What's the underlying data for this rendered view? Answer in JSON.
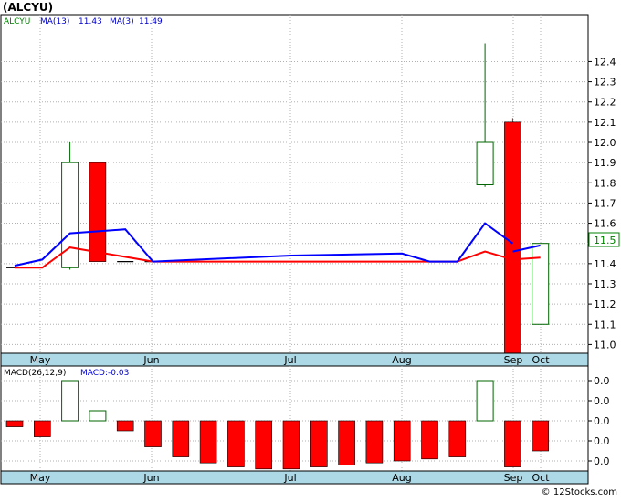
{
  "title": "(ALCYU)",
  "legend": {
    "ticker": "ALCYU",
    "ma13_label": "MA(13)",
    "ma13_value": "11.43",
    "ma3_label": "MA(3)",
    "ma3_value": "11.49"
  },
  "macd_legend": {
    "label": "MACD(26,12,9)",
    "value_label": "MACD:-0.03"
  },
  "current_price_label": "11.5",
  "watermark": "© 12Stocks.com",
  "colors": {
    "up": "#006400",
    "down": "#ff0000",
    "ma13": "#ff0000",
    "ma3": "#0000ff",
    "axis_band": "#add8e6",
    "legend_ticker": "#008000",
    "legend_ma": "#0000cd"
  },
  "chart_data": [
    {
      "type": "candlestick",
      "name": "price",
      "x_months": [
        "May",
        "Jun",
        "Jul",
        "Aug",
        "Sep",
        "Oct"
      ],
      "y_ticks": [
        "11.0",
        "11.1",
        "11.2",
        "11.3",
        "11.4",
        "11.5",
        "11.6",
        "11.7",
        "11.8",
        "11.9",
        "12.0",
        "12.1",
        "12.2",
        "12.3",
        "12.4"
      ],
      "ylim": [
        10.95,
        12.55
      ],
      "grid": true,
      "candles": [
        {
          "week": 0,
          "open": 11.38,
          "close": 11.38,
          "high": 11.38,
          "low": 11.38
        },
        {
          "week": 2,
          "open": 11.38,
          "close": 11.9,
          "high": 12.0,
          "low": 11.37
        },
        {
          "week": 3,
          "open": 11.9,
          "close": 11.41,
          "high": 11.9,
          "low": 11.41
        },
        {
          "week": 4,
          "open": 11.41,
          "close": 11.41,
          "high": 11.41,
          "low": 11.41
        },
        {
          "week": 5,
          "open": 11.41,
          "close": 11.41,
          "high": 11.41,
          "low": 11.41
        },
        {
          "week": 17,
          "open": 11.79,
          "close": 12.0,
          "high": 12.49,
          "low": 11.78
        },
        {
          "week": 18,
          "open": 12.1,
          "close": 10.91,
          "high": 12.12,
          "low": 10.91
        },
        {
          "week": 19,
          "open": 11.1,
          "close": 11.5,
          "high": 11.5,
          "low": 11.1
        }
      ],
      "ma13": {
        "name": "MA(13)",
        "points": [
          [
            0,
            11.38
          ],
          [
            1,
            11.38
          ],
          [
            2,
            11.48
          ],
          [
            5,
            11.41
          ],
          [
            10,
            11.41
          ],
          [
            16,
            11.41
          ],
          [
            17,
            11.46
          ],
          [
            18,
            11.42
          ],
          [
            19,
            11.43
          ]
        ]
      },
      "ma3": {
        "name": "MA(3)",
        "points": [
          [
            0,
            11.39
          ],
          [
            1,
            11.42
          ],
          [
            2,
            11.55
          ],
          [
            4,
            11.57
          ],
          [
            5,
            11.41
          ],
          [
            10,
            11.44
          ],
          [
            14,
            11.45
          ],
          [
            15,
            11.41
          ],
          [
            16,
            11.41
          ],
          [
            17,
            11.6
          ],
          [
            18,
            11.5
          ]
        ]
      },
      "ma3_tail": [
        [
          18,
          11.46
        ],
        [
          19,
          11.49
        ]
      ]
    },
    {
      "type": "bar",
      "name": "MACD(26,12,9)",
      "x_months": [
        "May",
        "Jun",
        "Jul",
        "Aug",
        "Sep",
        "Oct"
      ],
      "y_ticks": [
        "0.0",
        "0.0",
        "0.0",
        "0.0",
        "0.0"
      ],
      "ylim": [
        -0.04,
        0.03
      ],
      "grid": true,
      "bars": [
        {
          "week": 0,
          "value": -0.003
        },
        {
          "week": 1,
          "value": -0.008
        },
        {
          "week": 2,
          "value": 0.02
        },
        {
          "week": 3,
          "value": 0.005
        },
        {
          "week": 4,
          "value": -0.005
        },
        {
          "week": 5,
          "value": -0.013
        },
        {
          "week": 6,
          "value": -0.018
        },
        {
          "week": 7,
          "value": -0.021
        },
        {
          "week": 8,
          "value": -0.023
        },
        {
          "week": 9,
          "value": -0.024
        },
        {
          "week": 10,
          "value": -0.024
        },
        {
          "week": 11,
          "value": -0.023
        },
        {
          "week": 12,
          "value": -0.022
        },
        {
          "week": 13,
          "value": -0.021
        },
        {
          "week": 14,
          "value": -0.02
        },
        {
          "week": 15,
          "value": -0.019
        },
        {
          "week": 16,
          "value": -0.018
        },
        {
          "week": 17,
          "value": 0.02
        },
        {
          "week": 18,
          "value": -0.023
        },
        {
          "week": 19,
          "value": -0.015
        }
      ]
    }
  ]
}
